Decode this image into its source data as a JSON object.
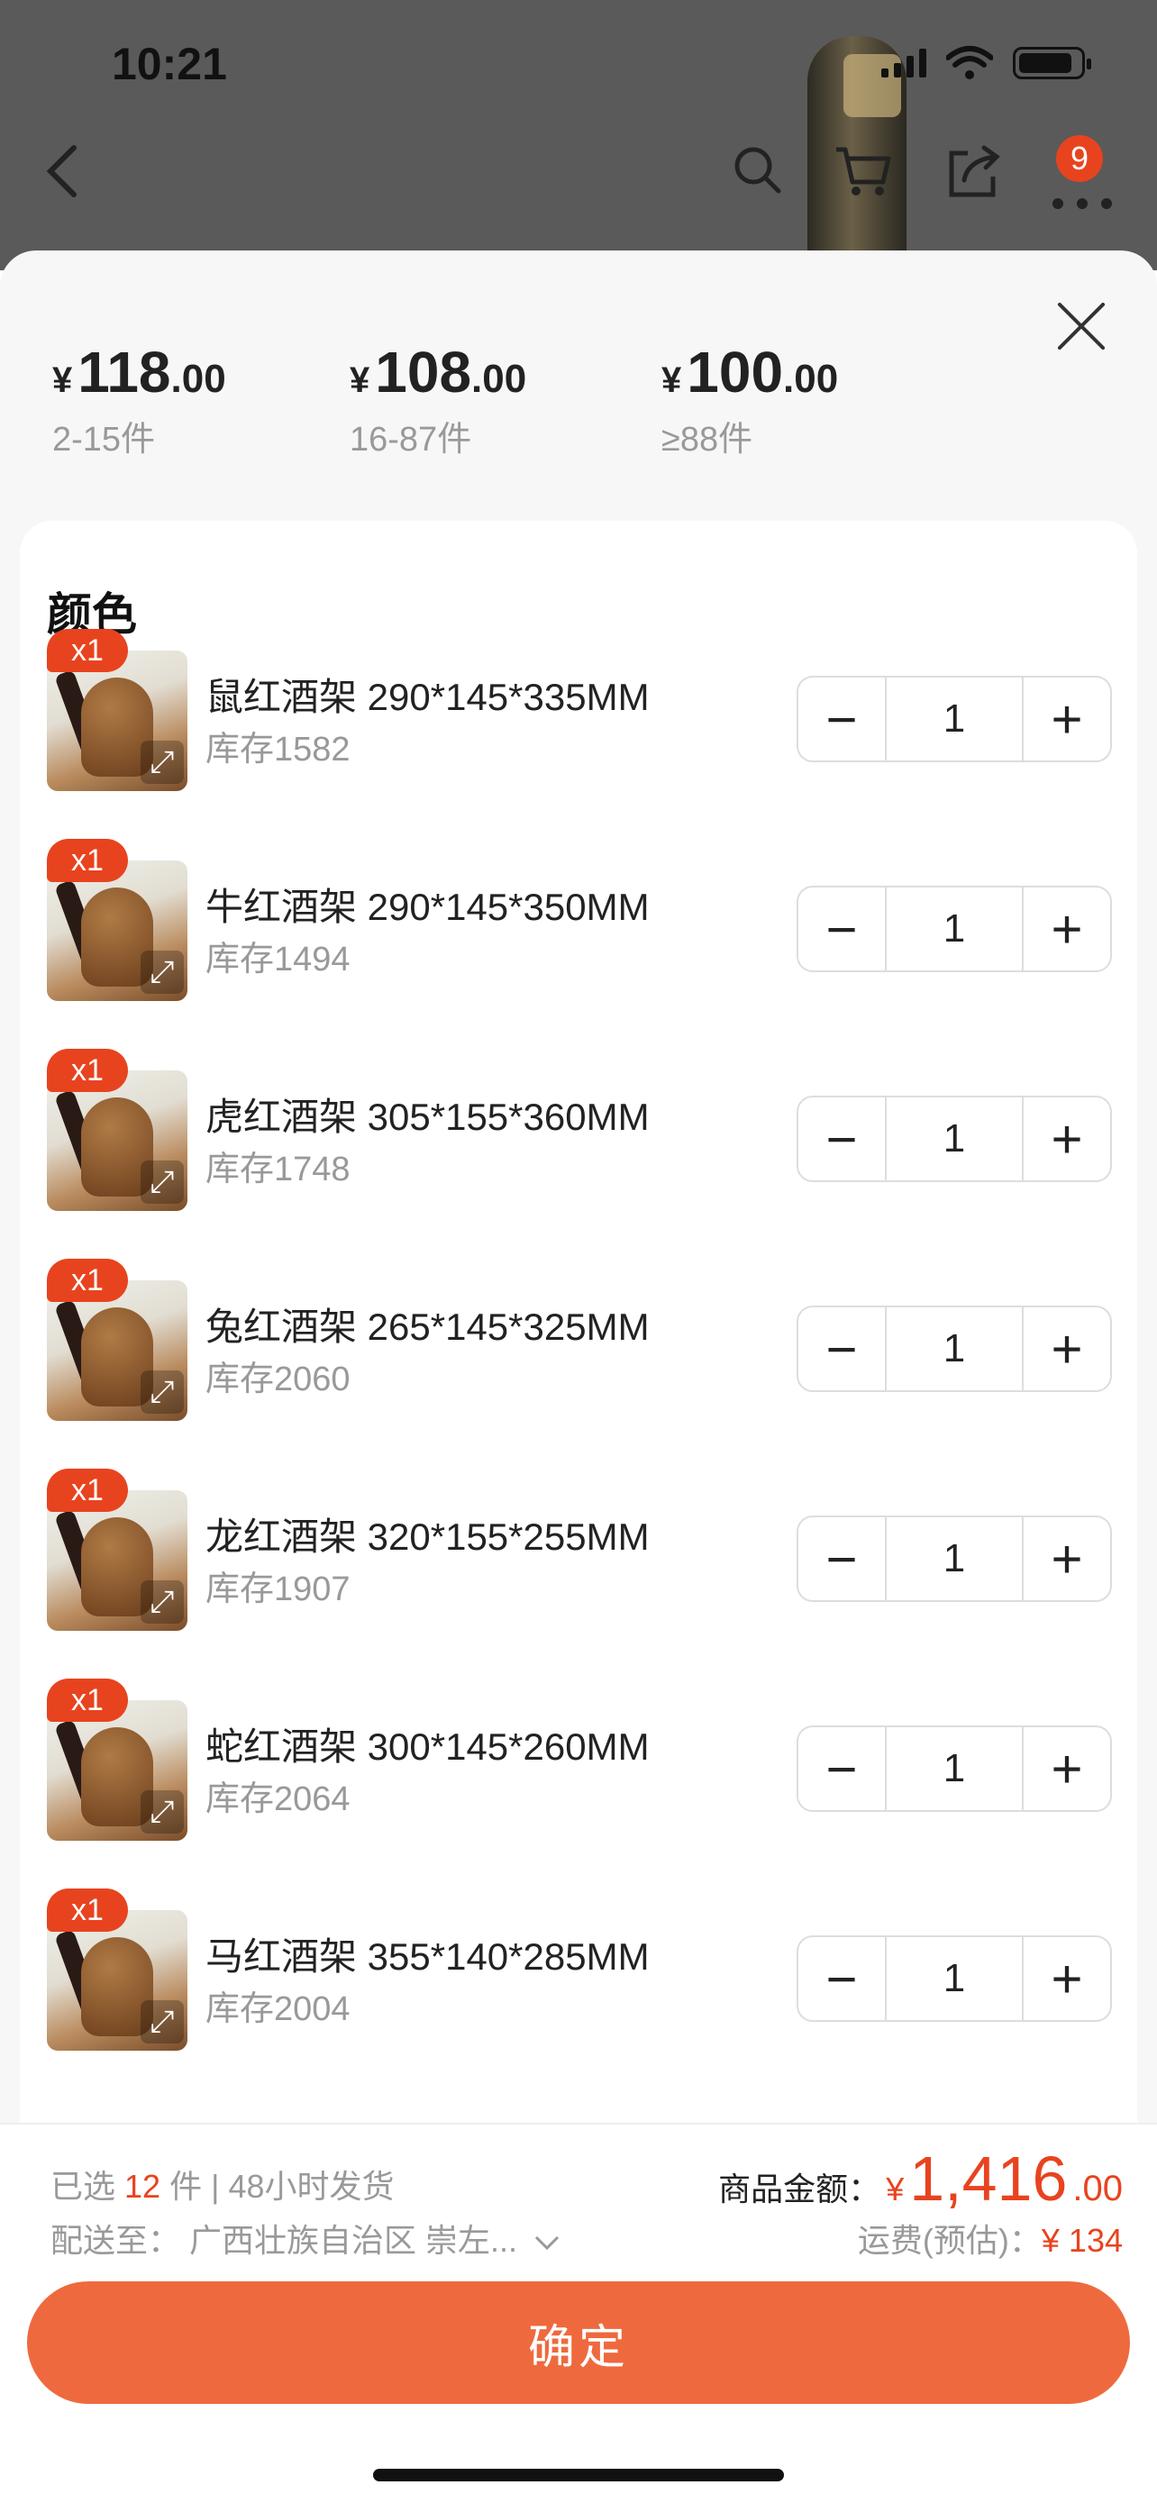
{
  "status_bar": {
    "time": "10:21"
  },
  "header": {
    "cart_badge": "9"
  },
  "price_tiers": [
    {
      "currency": "¥",
      "int": "118",
      "dec": ".00",
      "range": "2-15件"
    },
    {
      "currency": "¥",
      "int": "108",
      "dec": ".00",
      "range": "16-87件"
    },
    {
      "currency": "¥",
      "int": "100",
      "dec": ".00",
      "range": "≥88件"
    }
  ],
  "section_title": "颜色",
  "items": [
    {
      "badge": "x1",
      "name": "鼠红酒架 290*145*335MM",
      "stock": "库存1582",
      "qty": "1"
    },
    {
      "badge": "x1",
      "name": "牛红酒架 290*145*350MM",
      "stock": "库存1494",
      "qty": "1"
    },
    {
      "badge": "x1",
      "name": "虎红酒架 305*155*360MM",
      "stock": "库存1748",
      "qty": "1"
    },
    {
      "badge": "x1",
      "name": "兔红酒架 265*145*325MM",
      "stock": "库存2060",
      "qty": "1"
    },
    {
      "badge": "x1",
      "name": "龙红酒架 320*155*255MM",
      "stock": "库存1907",
      "qty": "1"
    },
    {
      "badge": "x1",
      "name": "蛇红酒架 300*145*260MM",
      "stock": "库存2064",
      "qty": "1"
    },
    {
      "badge": "x1",
      "name": "马红酒架 355*140*285MM",
      "stock": "库存2004",
      "qty": "1"
    }
  ],
  "footer": {
    "selected_prefix": "已选",
    "selected_count": "12",
    "selected_suffix": "件 | 48小时发货",
    "ship_to": "配送至：  广西壮族自治区 崇左...",
    "amount_label": "商品金额：",
    "amount_currency": "¥",
    "amount_int": "1,416",
    "amount_dec": ".00",
    "freight_label": "运费(预估)：",
    "freight_value": "¥ 134",
    "confirm_label": "确定"
  },
  "colors": {
    "accent": "#e8431f",
    "button": "#ee6a3e"
  }
}
